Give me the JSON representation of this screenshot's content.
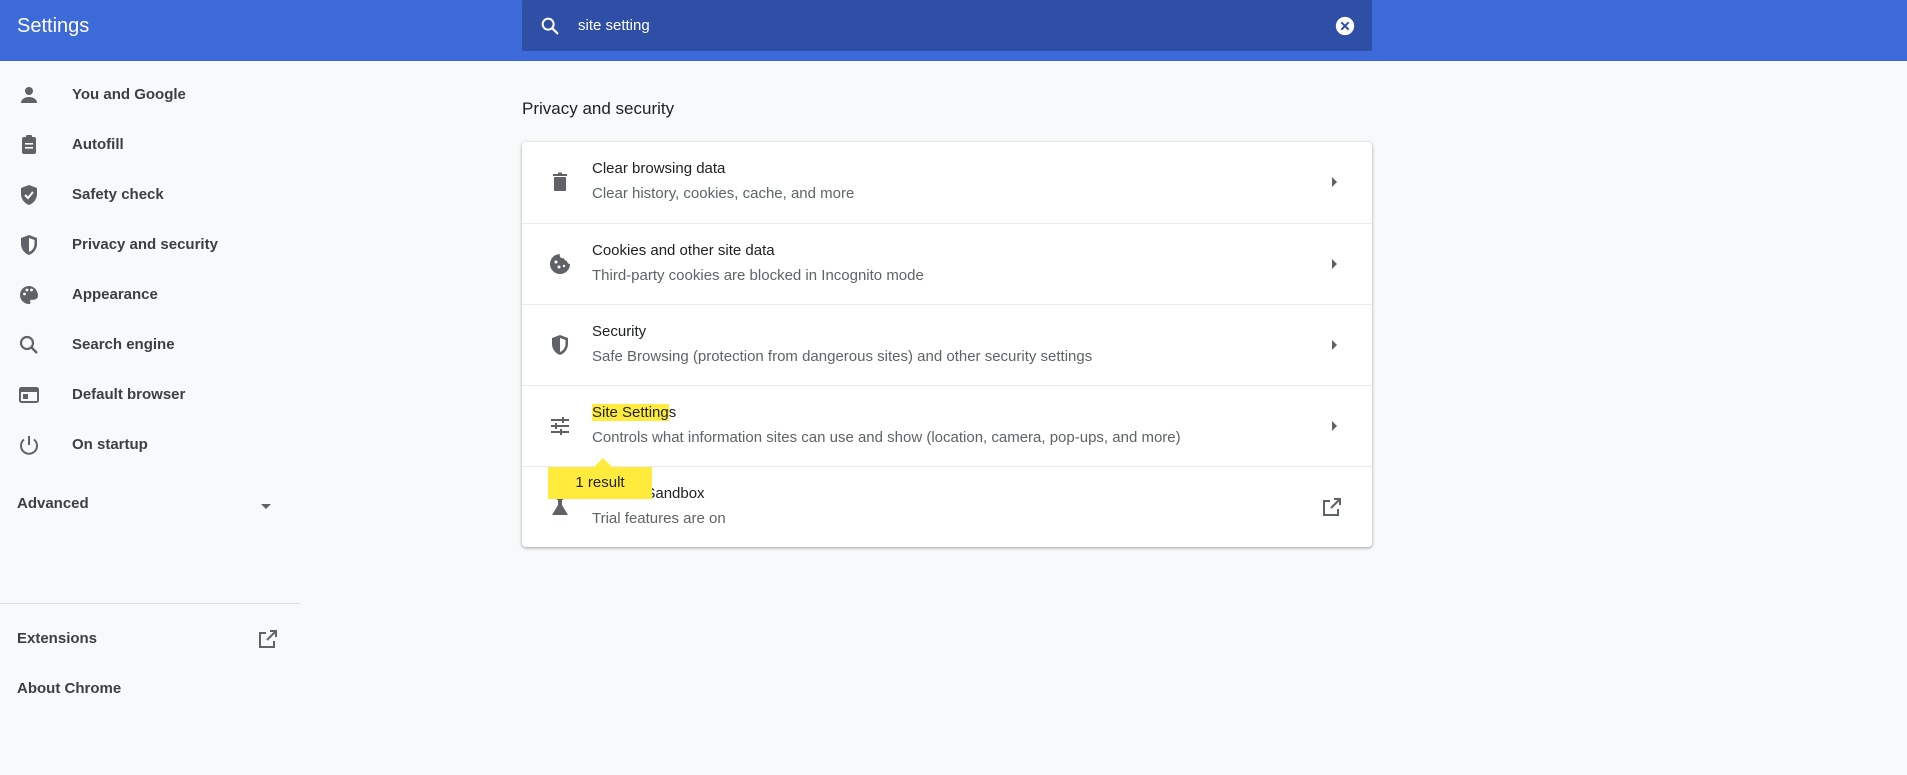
{
  "app": {
    "title": "Settings"
  },
  "search": {
    "value": "site setting",
    "clear_label": "Clear search"
  },
  "sidebar": {
    "items": [
      {
        "label": "You and Google",
        "icon": "person-icon"
      },
      {
        "label": "Autofill",
        "icon": "clipboard-icon"
      },
      {
        "label": "Safety check",
        "icon": "shield-check-icon"
      },
      {
        "label": "Privacy and security",
        "icon": "shield-half-icon"
      },
      {
        "label": "Appearance",
        "icon": "palette-icon"
      },
      {
        "label": "Search engine",
        "icon": "search-icon"
      },
      {
        "label": "Default browser",
        "icon": "browser-window-icon"
      },
      {
        "label": "On startup",
        "icon": "power-icon"
      }
    ],
    "advanced": "Advanced",
    "extensions": "Extensions",
    "about": "About Chrome"
  },
  "main": {
    "section_title": "Privacy and security",
    "rows": [
      {
        "title": "Clear browsing data",
        "subtitle": "Clear history, cookies, cache, and more",
        "icon": "trash-icon"
      },
      {
        "title": "Cookies and other site data",
        "subtitle": "Third-party cookies are blocked in Incognito mode",
        "icon": "cookie-icon"
      },
      {
        "title": "Security",
        "subtitle": "Safe Browsing (protection from dangerous sites) and other security settings",
        "icon": "shield-icon"
      },
      {
        "title_highlight": "Site Setting",
        "title_rest": "s",
        "subtitle": "Controls what information sites can use and show (location, camera, pop-ups, and more)",
        "icon": "tune-icon"
      },
      {
        "title": "Privacy Sandbox",
        "title_visible": "Sandbox",
        "subtitle": "Trial features are on",
        "icon": "flask-icon"
      }
    ],
    "search_bubble": "1 result"
  },
  "colors": {
    "header": "#3c6ad9",
    "search_box": "#2f4fa6",
    "highlight": "#ffeb3b"
  }
}
